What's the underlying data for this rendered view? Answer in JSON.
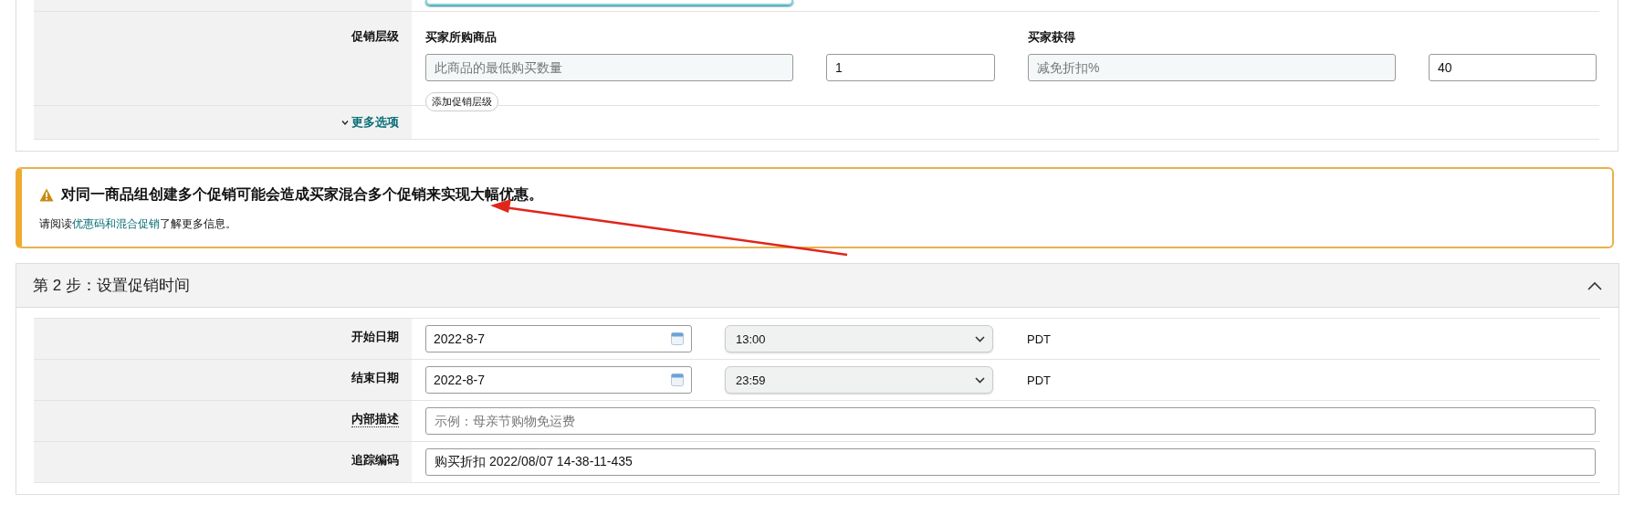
{
  "partial_row": {
    "field_focused": true
  },
  "promotion_tiers": {
    "label": "促销层级",
    "buyer_purchases_heading": "买家所购商品",
    "buyer_gets_heading": "买家获得",
    "tiers": [
      {
        "purchase_placeholder": "此商品的最低购买数量",
        "quantity": "1",
        "benefit_placeholder": "减免折扣%",
        "amount": "40"
      }
    ],
    "add_button": "添加促销层级"
  },
  "more_options": {
    "label": "更多选项",
    "expanded": false
  },
  "warning": {
    "title": "对同一商品组创建多个促销可能会造成买家混合多个促销来实现大幅优惠。",
    "text_before": "请阅读",
    "link": "优惠码和混合促销",
    "text_after": "了解更多信息。"
  },
  "step2": {
    "title": "第 2 步：设置促销时间",
    "expanded": true,
    "rows": [
      {
        "kind": "datetime",
        "label": "开始日期",
        "date": "2022-8-7",
        "time": "13:00",
        "timezone": "PDT"
      },
      {
        "kind": "datetime",
        "label": "结束日期",
        "date": "2022-8-7",
        "time": "23:59",
        "timezone": "PDT"
      },
      {
        "kind": "text",
        "label": "内部描述",
        "label_dotted": true,
        "placeholder": "示例：母亲节购物免运费"
      },
      {
        "kind": "text",
        "label": "追踪编码",
        "label_dotted": false,
        "value": "购买折扣 2022/08/07 14-38-11-435"
      }
    ]
  }
}
